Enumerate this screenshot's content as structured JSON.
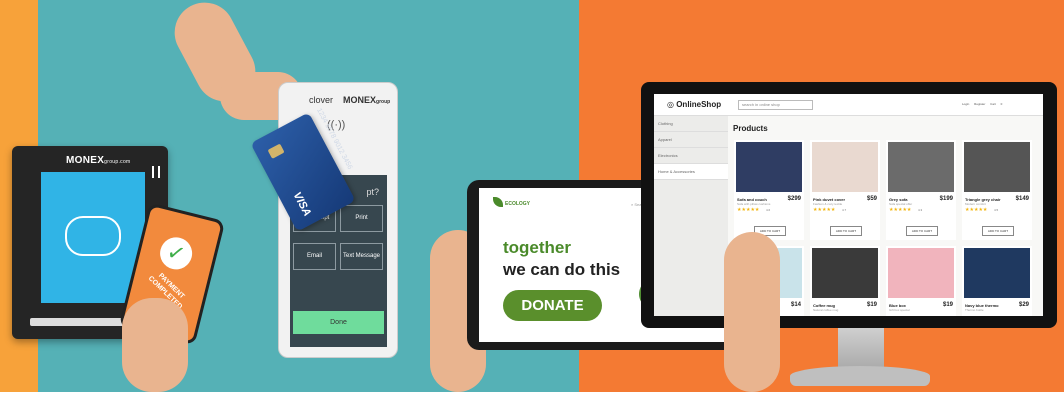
{
  "terminal_left": {
    "brand": "MONEX",
    "brand_suffix": "group.com"
  },
  "phone": {
    "message": "PAYMENT COMPLETED"
  },
  "terminal_right": {
    "brand_a": "clover",
    "brand_b": "MONEX",
    "brand_b_suffix": "group",
    "prompt": "pt?",
    "buttons": [
      "No Receipt",
      "Print",
      "Email",
      "Text Message"
    ],
    "done_label": "Done"
  },
  "card": {
    "brand": "VISA",
    "number": "1234 5678 9012 3456"
  },
  "tablet": {
    "logo": "ECOLOGY",
    "search_label": "Search",
    "line1": "together",
    "line2": "we can do this",
    "donate_label": "DONATE",
    "colors": {
      "green": "#5a8f2c"
    }
  },
  "shop": {
    "logo": "OnlineShop",
    "search_placeholder": "search in online shop",
    "header_right": "Login  Register  Cart  0",
    "sidebar": [
      "Clothing",
      "Apparel",
      "Electronics",
      "Home & Accessories"
    ],
    "title": "Products",
    "products": [
      {
        "name": "Sofa and couch",
        "sub": "Sofa with pillow cushions",
        "price": "$299",
        "stars": "★★★★★",
        "rating": "4.6",
        "cart": "ADD TO CART",
        "color": "#2f3d63"
      },
      {
        "name": "Pink duvet cover",
        "sub": "Fashion & cozy textile",
        "price": "$59",
        "stars": "★★★★★",
        "rating": "4.7",
        "cart": "ADD TO CART",
        "color": "#e9d9d0"
      },
      {
        "name": "Grey sofa",
        "sub": "Sofa special offer",
        "price": "$199",
        "stars": "★★★★★",
        "rating": "4.3",
        "cart": "ADD TO CART",
        "color": "#6b6b6b"
      },
      {
        "name": "Triangle grey chair",
        "sub": "Modern comfort",
        "price": "$149",
        "stars": "★★★★★",
        "rating": "4.5",
        "cart": "ADD TO CART",
        "color": "#555"
      },
      {
        "name": "",
        "sub": "",
        "price": "$14",
        "color": "#c9e3ea"
      },
      {
        "name": "Coffee mug",
        "sub": "Natural coffee mug",
        "price": "$19",
        "color": "#3a3a3a"
      },
      {
        "name": "Blue box",
        "sub": "Gift box special",
        "price": "$19",
        "color": "#f1b4bd"
      },
      {
        "name": "Navy blue thermo",
        "sub": "Thermo bottle",
        "price": "$29",
        "color": "#1f3960"
      }
    ]
  }
}
